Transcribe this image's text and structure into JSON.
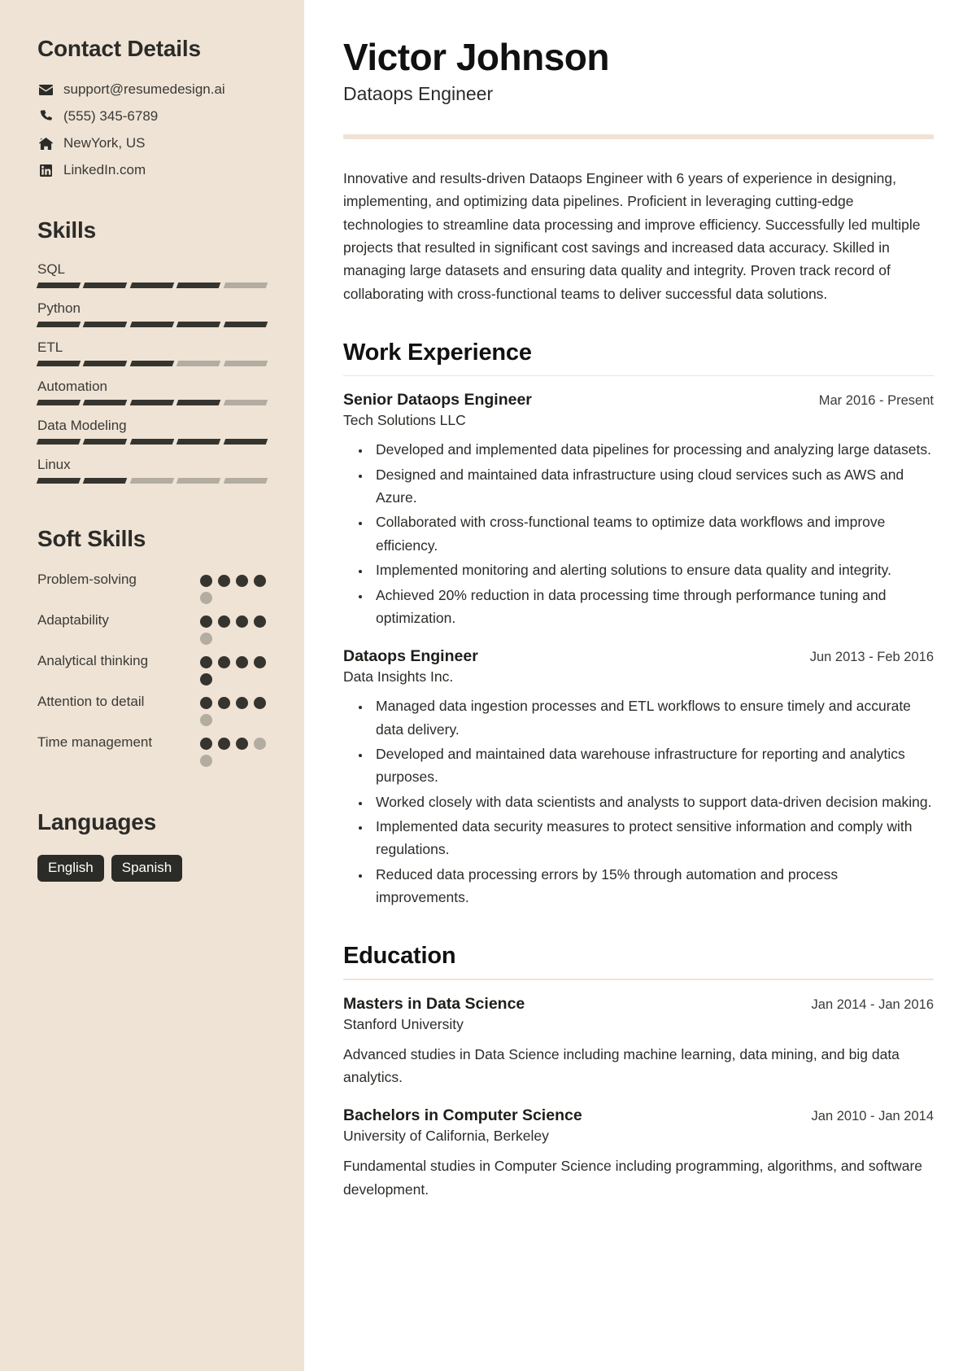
{
  "sidebar": {
    "contact": {
      "heading": "Contact Details",
      "items": [
        {
          "icon": "envelope-icon",
          "value": "support@resumedesign.ai"
        },
        {
          "icon": "phone-icon",
          "value": "(555) 345-6789"
        },
        {
          "icon": "home-icon",
          "value": "NewYork, US"
        },
        {
          "icon": "linkedin-icon",
          "value": "LinkedIn.com"
        }
      ]
    },
    "skills": {
      "heading": "Skills",
      "total_segments": 5,
      "items": [
        {
          "name": "SQL",
          "level": 4
        },
        {
          "name": "Python",
          "level": 5
        },
        {
          "name": "ETL",
          "level": 3
        },
        {
          "name": "Automation",
          "level": 4
        },
        {
          "name": "Data Modeling",
          "level": 5
        },
        {
          "name": "Linux",
          "level": 2
        }
      ]
    },
    "soft_skills": {
      "heading": "Soft Skills",
      "total_dots": 5,
      "items": [
        {
          "name": "Problem-solving",
          "level": 4
        },
        {
          "name": "Adaptability",
          "level": 4
        },
        {
          "name": "Analytical thinking",
          "level": 5
        },
        {
          "name": "Attention to detail",
          "level": 4
        },
        {
          "name": "Time management",
          "level": 3
        }
      ]
    },
    "languages": {
      "heading": "Languages",
      "items": [
        "English",
        "Spanish"
      ]
    }
  },
  "main": {
    "name": "Victor Johnson",
    "job_title": "Dataops Engineer",
    "summary": "Innovative and results-driven Dataops Engineer with 6 years of experience in designing, implementing, and optimizing data pipelines. Proficient in leveraging cutting-edge technologies to streamline data processing and improve efficiency. Successfully led multiple projects that resulted in significant cost savings and increased data accuracy. Skilled in managing large datasets and ensuring data quality and integrity. Proven track record of collaborating with cross-functional teams to deliver successful data solutions.",
    "work": {
      "heading": "Work Experience",
      "entries": [
        {
          "role": "Senior Dataops Engineer",
          "org": "Tech Solutions LLC",
          "date": "Mar 2016 - Present",
          "bullets": [
            "Developed and implemented data pipelines for processing and analyzing large datasets.",
            "Designed and maintained data infrastructure using cloud services such as AWS and Azure.",
            "Collaborated with cross-functional teams to optimize data workflows and improve efficiency.",
            "Implemented monitoring and alerting solutions to ensure data quality and integrity.",
            "Achieved 20% reduction in data processing time through performance tuning and optimization."
          ]
        },
        {
          "role": "Dataops Engineer",
          "org": "Data Insights Inc.",
          "date": "Jun 2013 - Feb 2016",
          "bullets": [
            "Managed data ingestion processes and ETL workflows to ensure timely and accurate data delivery.",
            "Developed and maintained data warehouse infrastructure for reporting and analytics purposes.",
            "Worked closely with data scientists and analysts to support data-driven decision making.",
            "Implemented data security measures to protect sensitive information and comply with regulations.",
            "Reduced data processing errors by 15% through automation and process improvements."
          ]
        }
      ]
    },
    "education": {
      "heading": "Education",
      "entries": [
        {
          "degree": "Masters in Data Science",
          "school": "Stanford University",
          "date": "Jan 2014 - Jan 2016",
          "description": "Advanced studies in Data Science including machine learning, data mining, and big data analytics."
        },
        {
          "degree": "Bachelors in Computer Science",
          "school": "University of California, Berkeley",
          "date": "Jan 2010 - Jan 2014",
          "description": "Fundamental studies in Computer Science including programming, algorithms, and software development."
        }
      ]
    }
  },
  "theme": {
    "sidebar_bg": "#efe3d5",
    "accent_rule": "#efe3d5",
    "filled": "#36342e",
    "empty": "#b3aca1",
    "badge_bg": "#2b2b28"
  }
}
